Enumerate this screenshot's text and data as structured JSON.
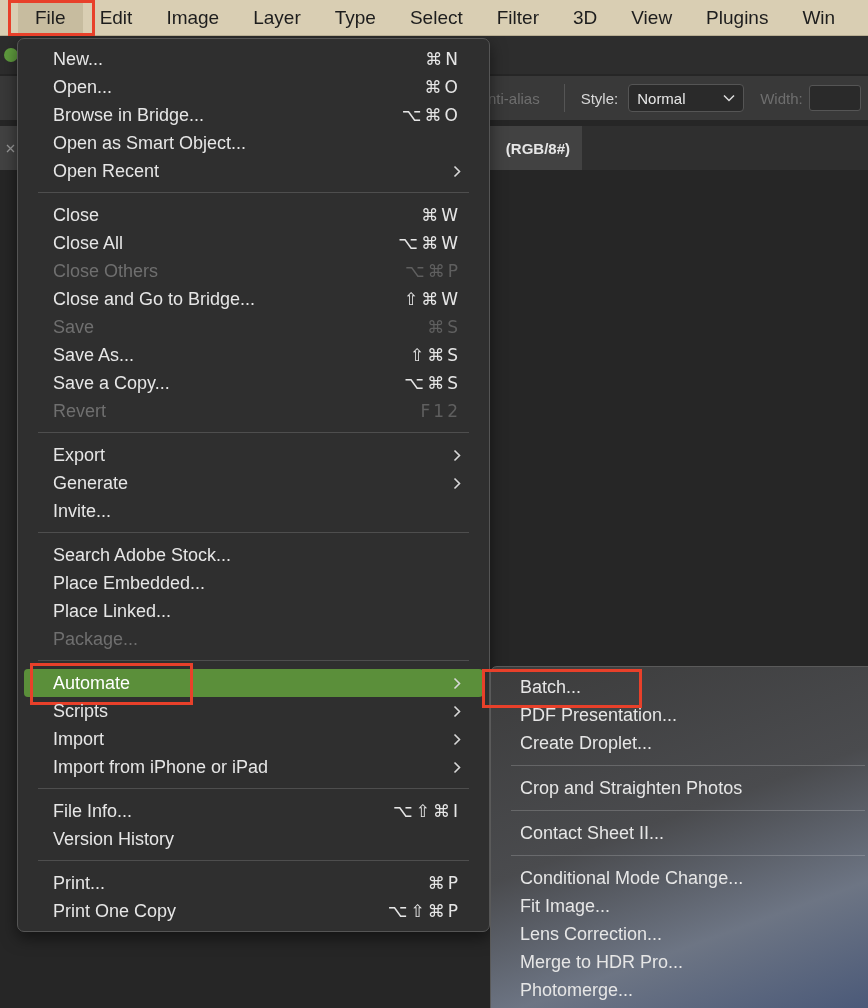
{
  "menubar": {
    "items": [
      {
        "label": "File",
        "selected": true,
        "annotated": true
      },
      {
        "label": "Edit",
        "selected": false,
        "annotated": false
      },
      {
        "label": "Image",
        "selected": false,
        "annotated": false
      },
      {
        "label": "Layer",
        "selected": false,
        "annotated": false
      },
      {
        "label": "Type",
        "selected": false,
        "annotated": false
      },
      {
        "label": "Select",
        "selected": false,
        "annotated": false
      },
      {
        "label": "Filter",
        "selected": false,
        "annotated": false
      },
      {
        "label": "3D",
        "selected": false,
        "annotated": false
      },
      {
        "label": "View",
        "selected": false,
        "annotated": false
      },
      {
        "label": "Plugins",
        "selected": false,
        "annotated": false
      },
      {
        "label": "Win",
        "selected": false,
        "annotated": false
      }
    ]
  },
  "options_bar": {
    "anti_alias": {
      "label": "nti-alias",
      "disabled": true
    },
    "style": {
      "label": "Style:",
      "value": "Normal"
    },
    "width": {
      "label": "Width:",
      "disabled": true
    }
  },
  "document_tab": {
    "title": "(RGB/8#)"
  },
  "file_menu": {
    "items": [
      {
        "kind": "item",
        "label": "New...",
        "shortcut": "⌘N",
        "submenu": false,
        "disabled": false,
        "selected": false,
        "annotated": false
      },
      {
        "kind": "item",
        "label": "Open...",
        "shortcut": "⌘O",
        "submenu": false,
        "disabled": false,
        "selected": false,
        "annotated": false
      },
      {
        "kind": "item",
        "label": "Browse in Bridge...",
        "shortcut": "⌥⌘O",
        "submenu": false,
        "disabled": false,
        "selected": false,
        "annotated": false
      },
      {
        "kind": "item",
        "label": "Open as Smart Object...",
        "submenu": false,
        "disabled": false,
        "selected": false,
        "annotated": false
      },
      {
        "kind": "item",
        "label": "Open Recent",
        "submenu": true,
        "disabled": false,
        "selected": false,
        "annotated": false
      },
      {
        "kind": "separator"
      },
      {
        "kind": "item",
        "label": "Close",
        "shortcut": "⌘W",
        "submenu": false,
        "disabled": false,
        "selected": false,
        "annotated": false
      },
      {
        "kind": "item",
        "label": "Close All",
        "shortcut": "⌥⌘W",
        "submenu": false,
        "disabled": false,
        "selected": false,
        "annotated": false
      },
      {
        "kind": "item",
        "label": "Close Others",
        "shortcut": "⌥⌘P",
        "submenu": false,
        "disabled": true,
        "selected": false,
        "annotated": false
      },
      {
        "kind": "item",
        "label": "Close and Go to Bridge...",
        "shortcut": "⇧⌘W",
        "submenu": false,
        "disabled": false,
        "selected": false,
        "annotated": false
      },
      {
        "kind": "item",
        "label": "Save",
        "shortcut": "⌘S",
        "submenu": false,
        "disabled": true,
        "selected": false,
        "annotated": false
      },
      {
        "kind": "item",
        "label": "Save As...",
        "shortcut": "⇧⌘S",
        "submenu": false,
        "disabled": false,
        "selected": false,
        "annotated": false
      },
      {
        "kind": "item",
        "label": "Save a Copy...",
        "shortcut": "⌥⌘S",
        "submenu": false,
        "disabled": false,
        "selected": false,
        "annotated": false
      },
      {
        "kind": "item",
        "label": "Revert",
        "shortcut": "F12",
        "submenu": false,
        "disabled": true,
        "selected": false,
        "annotated": false
      },
      {
        "kind": "separator"
      },
      {
        "kind": "item",
        "label": "Export",
        "submenu": true,
        "disabled": false,
        "selected": false,
        "annotated": false
      },
      {
        "kind": "item",
        "label": "Generate",
        "submenu": true,
        "disabled": false,
        "selected": false,
        "annotated": false
      },
      {
        "kind": "item",
        "label": "Invite...",
        "submenu": false,
        "disabled": false,
        "selected": false,
        "annotated": false
      },
      {
        "kind": "separator"
      },
      {
        "kind": "item",
        "label": "Search Adobe Stock...",
        "submenu": false,
        "disabled": false,
        "selected": false,
        "annotated": false
      },
      {
        "kind": "item",
        "label": "Place Embedded...",
        "submenu": false,
        "disabled": false,
        "selected": false,
        "annotated": false
      },
      {
        "kind": "item",
        "label": "Place Linked...",
        "submenu": false,
        "disabled": false,
        "selected": false,
        "annotated": false
      },
      {
        "kind": "item",
        "label": "Package...",
        "submenu": false,
        "disabled": true,
        "selected": false,
        "annotated": false
      },
      {
        "kind": "separator"
      },
      {
        "kind": "item",
        "label": "Automate",
        "submenu": true,
        "disabled": false,
        "selected": true,
        "annotated": true
      },
      {
        "kind": "item",
        "label": "Scripts",
        "submenu": true,
        "disabled": false,
        "selected": false,
        "annotated": false
      },
      {
        "kind": "item",
        "label": "Import",
        "submenu": true,
        "disabled": false,
        "selected": false,
        "annotated": false
      },
      {
        "kind": "item",
        "label": "Import from iPhone or iPad",
        "submenu": true,
        "disabled": false,
        "selected": false,
        "annotated": false
      },
      {
        "kind": "separator"
      },
      {
        "kind": "item",
        "label": "File Info...",
        "shortcut": "⌥⇧⌘I",
        "submenu": false,
        "disabled": false,
        "selected": false,
        "annotated": false
      },
      {
        "kind": "item",
        "label": "Version History",
        "submenu": false,
        "disabled": false,
        "selected": false,
        "annotated": false
      },
      {
        "kind": "separator"
      },
      {
        "kind": "item",
        "label": "Print...",
        "shortcut": "⌘P",
        "submenu": false,
        "disabled": false,
        "selected": false,
        "annotated": false
      },
      {
        "kind": "item",
        "label": "Print One Copy",
        "shortcut": "⌥⇧⌘P",
        "submenu": false,
        "disabled": false,
        "selected": false,
        "annotated": false
      }
    ]
  },
  "automate_submenu": {
    "items": [
      {
        "kind": "item",
        "label": "Batch...",
        "submenu": false,
        "disabled": false,
        "selected": false,
        "annotated": true
      },
      {
        "kind": "item",
        "label": "PDF Presentation...",
        "submenu": false,
        "disabled": false,
        "selected": false,
        "annotated": false
      },
      {
        "kind": "item",
        "label": "Create Droplet...",
        "submenu": false,
        "disabled": false,
        "selected": false,
        "annotated": false
      },
      {
        "kind": "separator"
      },
      {
        "kind": "item",
        "label": "Crop and Straighten Photos",
        "submenu": false,
        "disabled": false,
        "selected": false,
        "annotated": false
      },
      {
        "kind": "separator"
      },
      {
        "kind": "item",
        "label": "Contact Sheet II...",
        "submenu": false,
        "disabled": false,
        "selected": false,
        "annotated": false
      },
      {
        "kind": "separator"
      },
      {
        "kind": "item",
        "label": "Conditional Mode Change...",
        "submenu": false,
        "disabled": false,
        "selected": false,
        "annotated": false
      },
      {
        "kind": "item",
        "label": "Fit Image...",
        "submenu": false,
        "disabled": false,
        "selected": false,
        "annotated": false
      },
      {
        "kind": "item",
        "label": "Lens Correction...",
        "submenu": false,
        "disabled": false,
        "selected": false,
        "annotated": false
      },
      {
        "kind": "item",
        "label": "Merge to HDR Pro...",
        "submenu": false,
        "disabled": false,
        "selected": false,
        "annotated": false
      },
      {
        "kind": "item",
        "label": "Photomerge...",
        "submenu": false,
        "disabled": false,
        "selected": false,
        "annotated": false
      }
    ]
  }
}
